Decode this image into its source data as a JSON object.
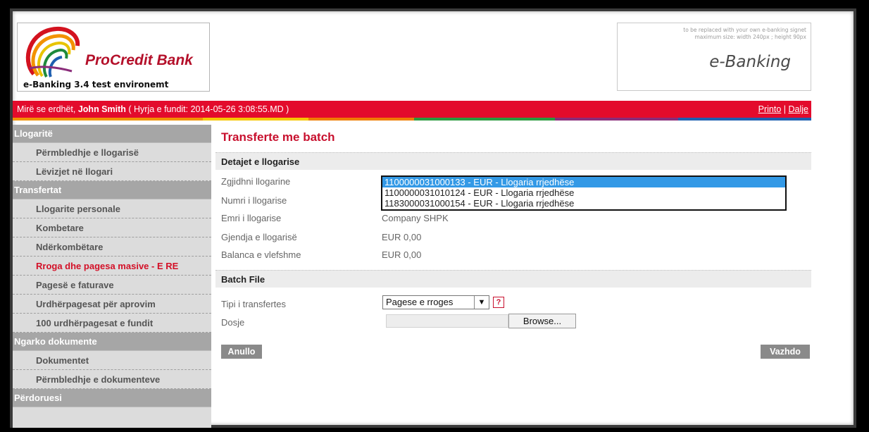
{
  "header": {
    "bank_name": "ProCredit Bank",
    "environment": "e-Banking 3.4 test environemt",
    "signet_note_line1": "to be replaced with your own e-banking signet",
    "signet_note_line2": "maximum size:  width 240px ; height 90px",
    "signet_title": "e-Banking"
  },
  "welcome": {
    "prefix": "Mirë se erdhët, ",
    "user": "John Smith",
    "login_info": " ( Hyrja e fundit: 2014-05-26 3:08:55.MD )",
    "print_link": "Printo",
    "separator": " | ",
    "logout_link": "Dalje"
  },
  "sidebar": {
    "sections": [
      {
        "label": "Llogaritë",
        "items": [
          "Përmbledhje e llogarisë",
          "Lëvizjet në llogari"
        ]
      },
      {
        "label": "Transfertat",
        "items": [
          "Llogarite personale",
          "Kombetare",
          "Ndërkombëtare",
          "Rroga dhe pagesa masive - E RE",
          "Pagesë e faturave",
          "Urdhërpagesat për aprovim",
          "100 urdhërpagesat e fundit"
        ]
      },
      {
        "label": "Ngarko dokumente",
        "items": [
          "Dokumentet",
          "Përmbledhje e dokumenteve"
        ]
      },
      {
        "label": "Përdoruesi",
        "items": []
      }
    ],
    "active_item": "Rroga dhe pagesa masive - E RE"
  },
  "main": {
    "title": "Transferte me batch",
    "details": {
      "heading": "Detajet e llogarise",
      "select_label": "Zgjidhni llogarine",
      "account_number_label": "Numri i llogarise",
      "account_name_label": "Emri i llogarise",
      "account_name_value": "Company SHPK",
      "state_label": "Gjendja e llogarisë",
      "state_value": "EUR 0,00",
      "balance_label": "Balanca e vlefshme",
      "balance_value": "EUR 0,00",
      "accounts": [
        "1100000031000133 - EUR - Llogaria rrjedhëse",
        "1100000031010124 - EUR - Llogaria rrjedhëse",
        "1183000031000154 - EUR - Llogaria rrjedhëse"
      ],
      "selected_index": 0
    },
    "batch": {
      "heading": "Batch File",
      "type_label": "Tipi i transfertes",
      "type_value": "Pagese e rroges",
      "help_glyph": "?",
      "file_label": "Dosje",
      "browse_label": "Browse..."
    },
    "buttons": {
      "cancel": "Anullo",
      "continue": "Vazhdo"
    }
  },
  "colors": {
    "brand_red": "#e30b2c",
    "title_red": "#c8102e",
    "sidebar_section": "#a6a6a6",
    "sidebar_bg": "#dcdcdc",
    "selection_blue": "#3399e6"
  },
  "icons": {
    "logo": "procredit-logo-icon",
    "dropdown": "chevron-down-icon",
    "help": "help-icon"
  }
}
